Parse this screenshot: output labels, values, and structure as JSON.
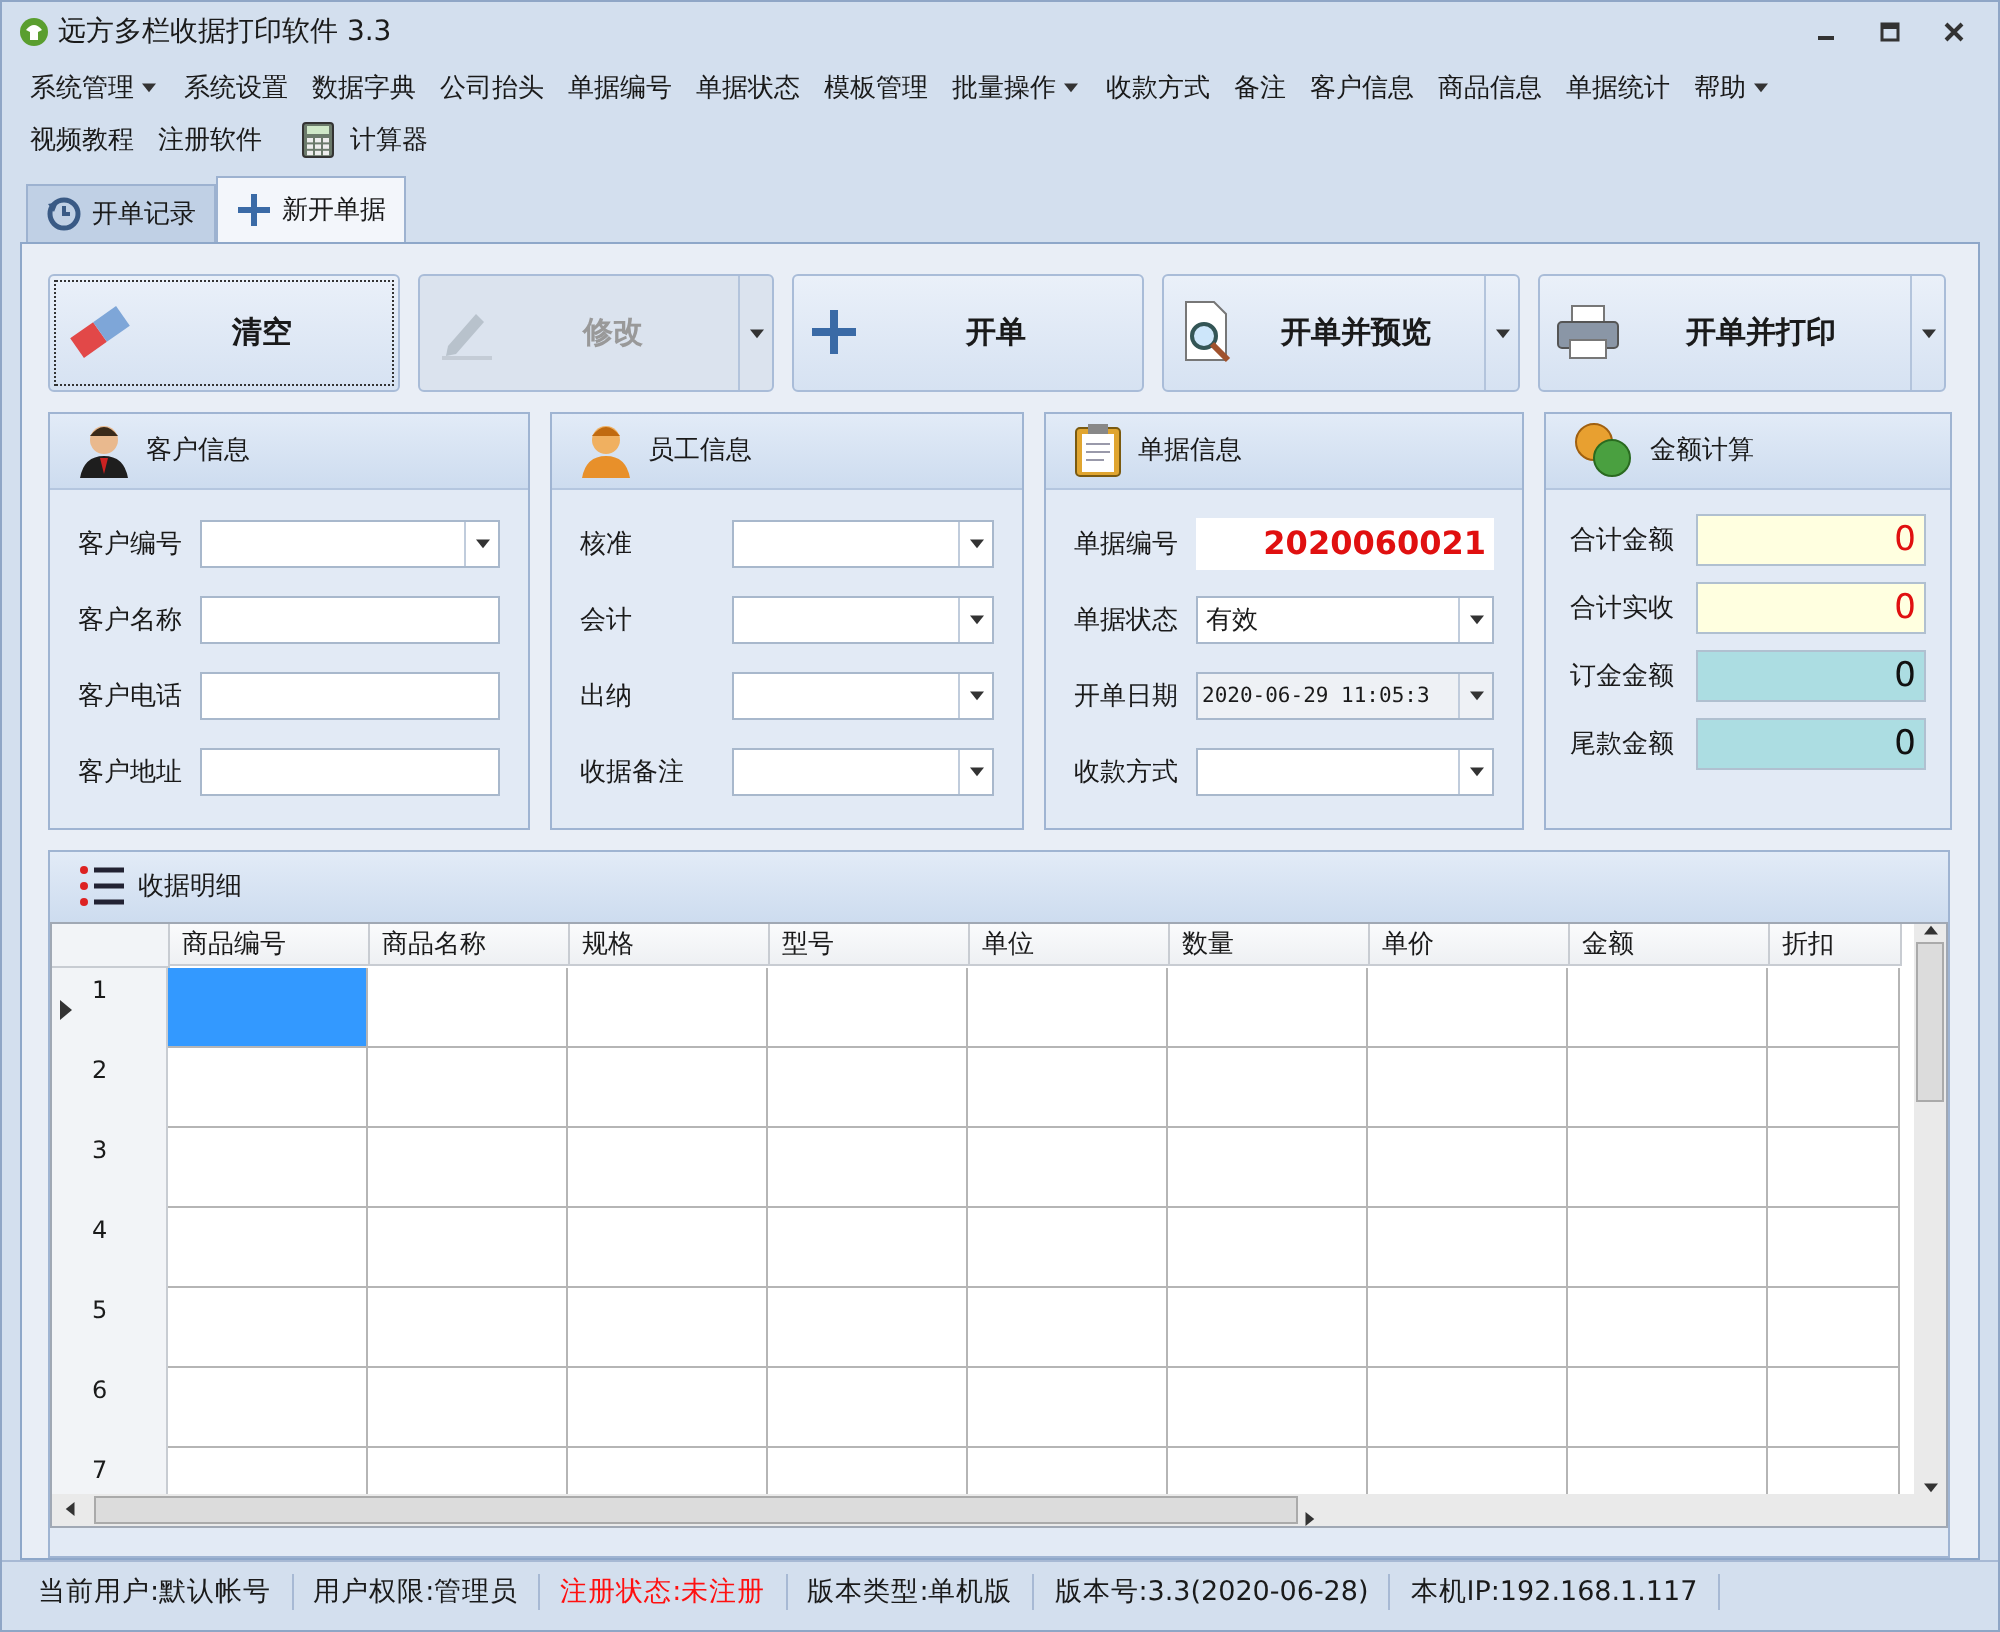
{
  "window": {
    "title": "远方多栏收据打印软件 3.3"
  },
  "menu": {
    "rows": [
      [
        {
          "label": "系统管理",
          "kind": "dropdown"
        },
        {
          "label": "系统设置",
          "kind": "item"
        },
        {
          "label": "数据字典",
          "kind": "item"
        },
        {
          "label": "公司抬头",
          "kind": "item"
        },
        {
          "label": "单据编号",
          "kind": "item"
        },
        {
          "label": "单据状态",
          "kind": "item"
        },
        {
          "label": "模板管理",
          "kind": "item"
        },
        {
          "label": "批量操作",
          "kind": "dropdown"
        },
        {
          "label": "收款方式",
          "kind": "item"
        },
        {
          "label": "备注",
          "kind": "item"
        },
        {
          "label": "客户信息",
          "kind": "item"
        },
        {
          "label": "商品信息",
          "kind": "item"
        },
        {
          "label": "单据统计",
          "kind": "item"
        },
        {
          "label": "帮助",
          "kind": "dropdown"
        }
      ],
      [
        {
          "label": "视频教程",
          "kind": "item"
        },
        {
          "label": "注册软件",
          "kind": "item"
        },
        {
          "label": "计算器",
          "kind": "tool"
        }
      ]
    ]
  },
  "tabs": [
    {
      "label": "开单记录",
      "kind": "history",
      "selected": false
    },
    {
      "label": "新开单据",
      "kind": "new",
      "selected": true
    }
  ],
  "toolbar": [
    {
      "label": "清空",
      "kind": "eraser",
      "disabled": false,
      "focused": true,
      "dropdown": false
    },
    {
      "label": "修改",
      "kind": "pencil",
      "disabled": true,
      "focused": false,
      "dropdown": true
    },
    {
      "label": "开单",
      "kind": "plus",
      "disabled": false,
      "focused": false,
      "dropdown": false
    },
    {
      "label": "开单并预览",
      "kind": "preview",
      "disabled": false,
      "focused": false,
      "dropdown": true
    },
    {
      "label": "开单并打印",
      "kind": "printer",
      "disabled": false,
      "focused": false,
      "dropdown": true
    }
  ],
  "groups": [
    {
      "title": "客户信息",
      "kind": "customer",
      "fields": [
        {
          "label": "客户编号",
          "kind": "combo"
        },
        {
          "label": "客户名称",
          "kind": "text"
        },
        {
          "label": "客户电话",
          "kind": "text"
        },
        {
          "label": "客户地址",
          "kind": "text"
        }
      ]
    },
    {
      "title": "员工信息",
      "kind": "staff",
      "fields": [
        {
          "label": "核准",
          "kind": "combo"
        },
        {
          "label": "会计",
          "kind": "combo"
        },
        {
          "label": "出纳",
          "kind": "combo"
        },
        {
          "label": "收据备注",
          "kind": "combo"
        }
      ]
    },
    {
      "title": "单据信息",
      "kind": "bill",
      "fields": [
        {
          "label": "单据编号",
          "kind": "readout",
          "value": "2020060021"
        },
        {
          "label": "单据状态",
          "kind": "combo",
          "value": "有效"
        },
        {
          "label": "开单日期",
          "kind": "date",
          "value": "2020-06-29 11:05:3"
        },
        {
          "label": "收款方式",
          "kind": "combo"
        }
      ]
    },
    {
      "title": "金额计算",
      "kind": "money",
      "fields": [
        {
          "label": "合计金额",
          "kind": "total",
          "value": "0"
        },
        {
          "label": "合计实收",
          "kind": "total",
          "value": "0"
        },
        {
          "label": "订金金额",
          "kind": "amount",
          "value": "0"
        },
        {
          "label": "尾款金额",
          "kind": "amount",
          "value": "0"
        }
      ]
    }
  ],
  "details": {
    "title": "收据明细",
    "columns": [
      "商品编号",
      "商品名称",
      "规格",
      "型号",
      "单位",
      "数量",
      "单价",
      "金额",
      "折扣"
    ],
    "rows": [
      {
        "number": "1",
        "selected": true
      },
      {
        "number": "2",
        "selected": false
      },
      {
        "number": "3",
        "selected": false
      },
      {
        "number": "4",
        "selected": false
      },
      {
        "number": "5",
        "selected": false
      },
      {
        "number": "6",
        "selected": false
      },
      {
        "number": "7",
        "selected": false
      }
    ]
  },
  "status_bar": [
    {
      "text": "当前用户:默认帐号",
      "kind": "normal"
    },
    {
      "text": "用户权限:管理员",
      "kind": "normal"
    },
    {
      "text": "注册状态:未注册",
      "kind": "warning"
    },
    {
      "text": "版本类型:单机版",
      "kind": "normal"
    },
    {
      "text": "版本号:3.3(2020-06-28)",
      "kind": "normal"
    },
    {
      "text": "本机IP:192.168.1.117",
      "kind": "normal"
    }
  ]
}
